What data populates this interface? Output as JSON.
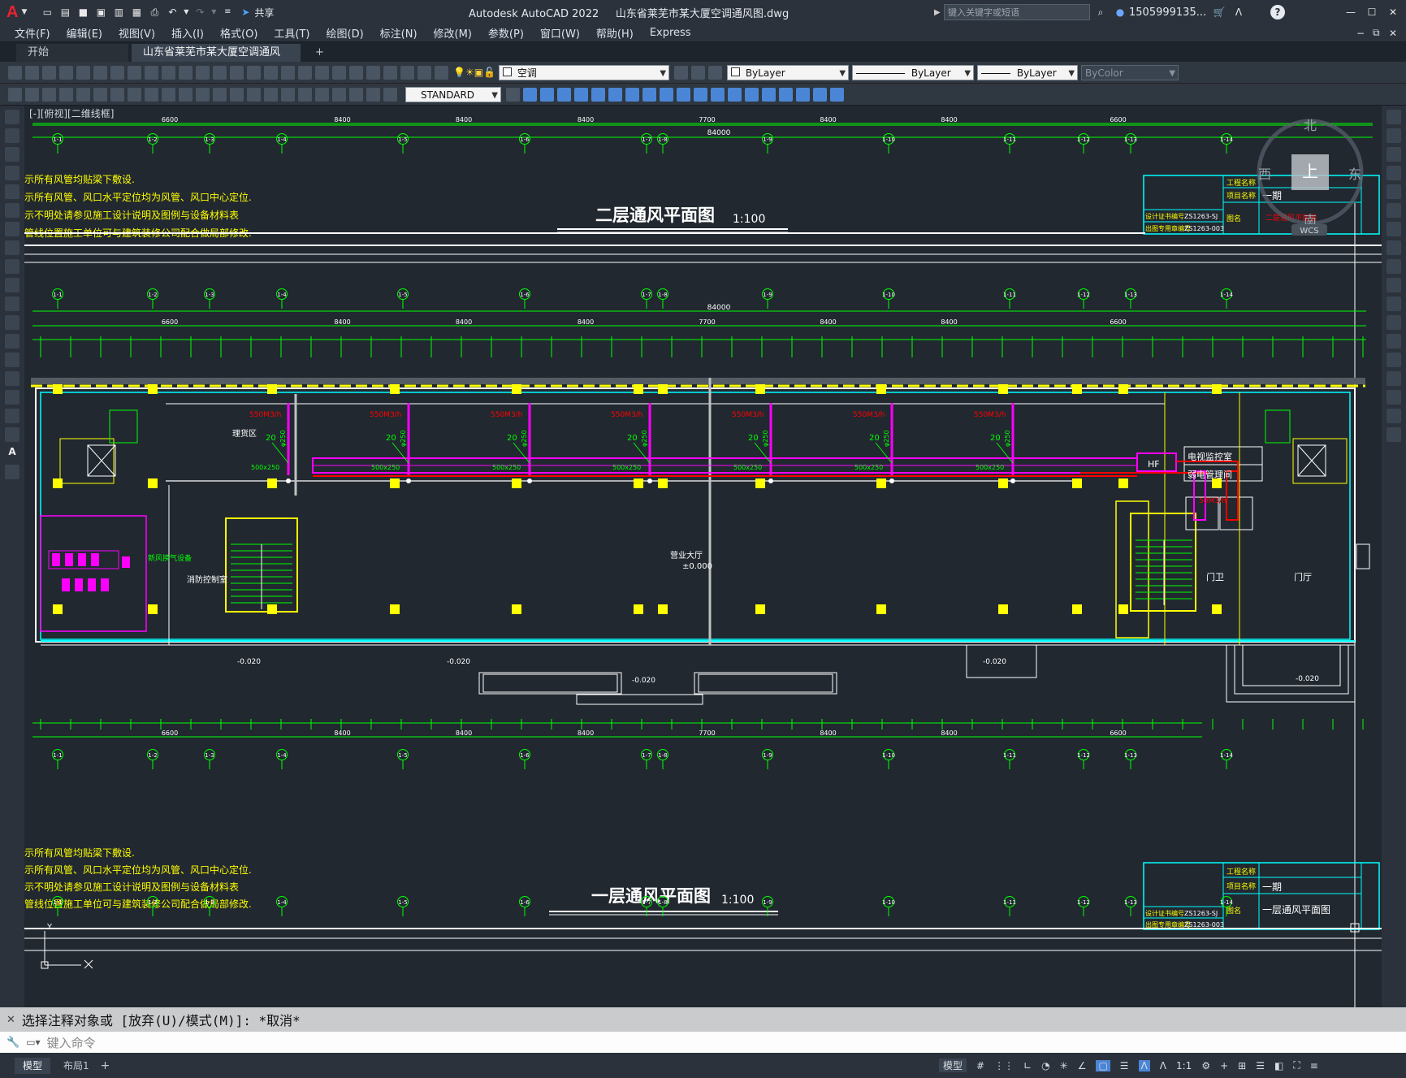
{
  "app": {
    "logo": "A",
    "title": "Autodesk AutoCAD 2022",
    "filename": "山东省莱芜市某大厦空调通风图.dwg",
    "share_label": "共享",
    "search_placeholder": "键入关键字或短语",
    "user": "1505999135...",
    "help": "?"
  },
  "menu": [
    "文件(F)",
    "编辑(E)",
    "视图(V)",
    "插入(I)",
    "格式(O)",
    "工具(T)",
    "绘图(D)",
    "标注(N)",
    "修改(M)",
    "参数(P)",
    "窗口(W)",
    "帮助(H)",
    "Express"
  ],
  "tabs": [
    {
      "label": "开始"
    },
    {
      "label": "山东省莱芜市某大厦空调通风图*",
      "close": "×"
    }
  ],
  "toolbar1": {
    "layer_value": "空调",
    "color_value": "ByLayer",
    "linetype_value": "ByLayer",
    "lineweight_value": "ByLayer",
    "plotstyle_value": "ByColor"
  },
  "toolbar2": {
    "textstyle_value": "STANDARD"
  },
  "viewport_label": "[-][俯视][二维线框]",
  "viewcube": {
    "north": "北",
    "south": "南",
    "east": "东",
    "west": "西",
    "top": "上",
    "wcs": "WCS"
  },
  "drawing": {
    "upper_title": "二层通风平面图",
    "lower_title": "一层通风平面图",
    "scale": "1:100",
    "notes": [
      "示所有风管均贴梁下敷设.",
      "示所有风管、风口水平定位均为风管、风口中心定位.",
      "示不明处请参见施工设计说明及图例与设备材料表",
      "管线位置施工单位可与建筑装修公司配合做局部修改."
    ],
    "grid_axes": [
      "1-1",
      "1-2",
      "1-3",
      "1-4",
      "1-5",
      "1-6",
      "1-7",
      "1-8",
      "1-9",
      "1-10",
      "1-11",
      "1-12",
      "1-13",
      "1-14"
    ],
    "dim_total": "84000",
    "dims_main": [
      "6600",
      "8400",
      "8400",
      "8400",
      "7700",
      "8400",
      "8400",
      "6600"
    ],
    "airflow_label": "550M3/h",
    "duct_label": "500x250",
    "branch_label": "φ250",
    "num_tag": "20",
    "rooms": [
      "理货区",
      "营业大厅",
      "消防控制室",
      "电视监控室",
      "弱电管理间",
      "门卫",
      "门厅",
      "新风换气设备"
    ],
    "room_airflow": "50M3/h",
    "elev_zero": "±0.000",
    "elev_neg": "-0.020",
    "hf_label": "HF",
    "title_block": {
      "project_label": "工程名称",
      "item_label": "项目名称",
      "item_value": "一期",
      "code_label": "设计证书编号",
      "code_value": "ZS1263-SJ",
      "code2_label": "出图专用章编号",
      "code2_value": "ZS1263-003",
      "drawing_name_label": "图名",
      "upper_drawing_name": "二层通风平面图",
      "lower_drawing_name": "一层通风平面图"
    }
  },
  "command": {
    "history": "选择注释对象或 [放弃(U)/模式(M)]: *取消*",
    "placeholder": "键入命令"
  },
  "status": {
    "tabs": [
      "模型",
      "布局1"
    ],
    "plus": "+",
    "model_label": "模型",
    "scale": "1:1"
  },
  "colors": {
    "green": "#00ff00",
    "yellow": "#ffff00",
    "cyan": "#00ffff",
    "red": "#ff0000",
    "magenta": "#ff00ff",
    "white": "#ffffff",
    "bg": "#212830"
  },
  "icons": [
    "autocad-logo",
    "new-icon",
    "open-icon",
    "save-icon",
    "saveas-icon",
    "plot-icon",
    "undo-icon",
    "redo-icon",
    "share-icon",
    "search-icon",
    "user-icon",
    "cart-icon",
    "help-icon",
    "minimize-icon",
    "maximize-icon",
    "close-icon"
  ]
}
